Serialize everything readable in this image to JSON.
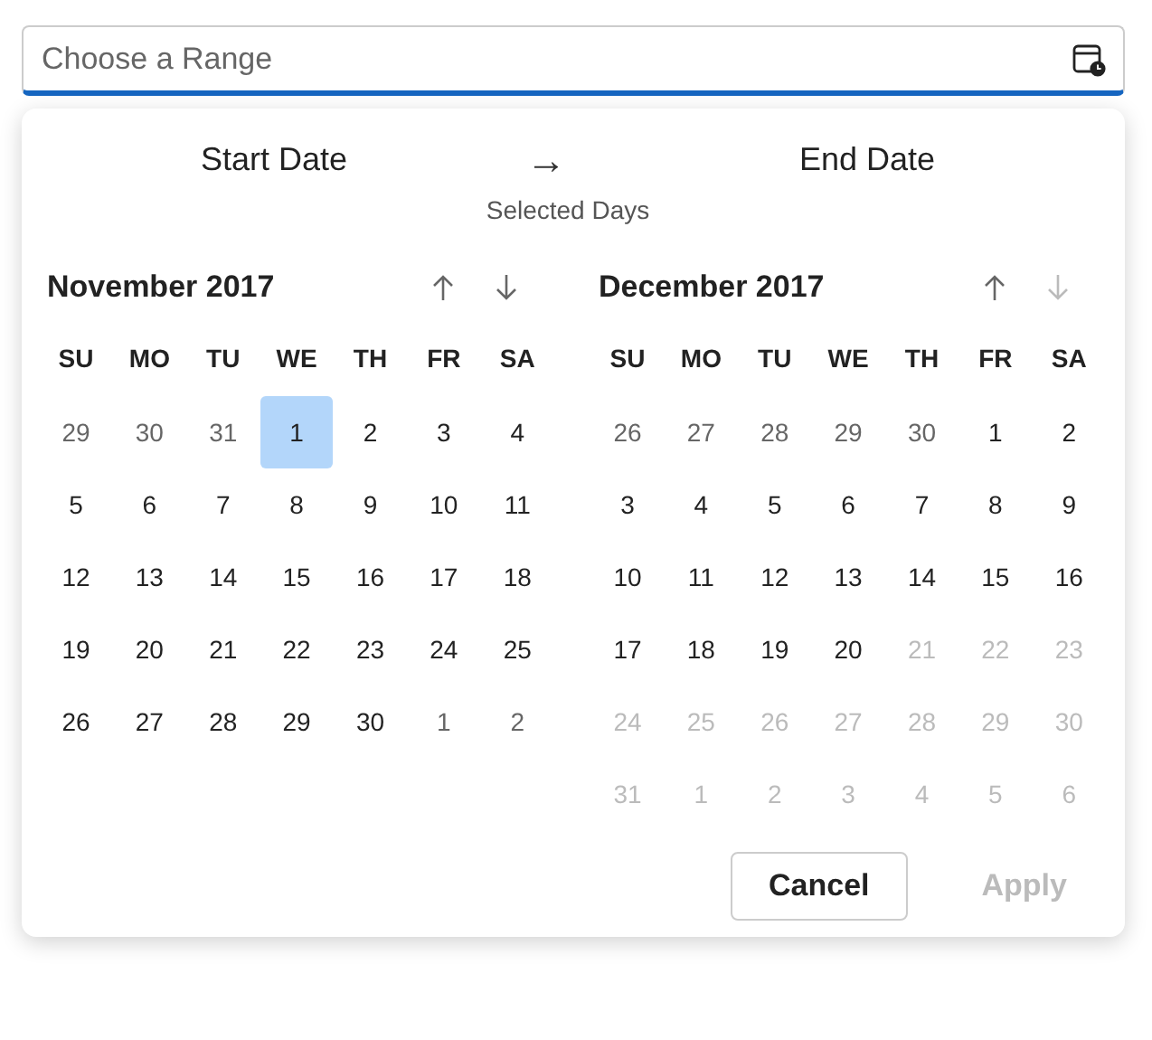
{
  "range_field": {
    "placeholder": "Choose a Range",
    "focused": true
  },
  "header": {
    "start_label": "Start Date",
    "arrow": "→",
    "end_label": "End Date",
    "caption": "Selected Days"
  },
  "months": [
    {
      "title": "November 2017",
      "nav": [
        {
          "kind": "up",
          "disabled": false
        },
        {
          "kind": "down",
          "disabled": false
        }
      ],
      "weekdays": [
        "SU",
        "MO",
        "TU",
        "WE",
        "TH",
        "FR",
        "SA"
      ],
      "weeks": [
        [
          {
            "label": "29",
            "kind": "out",
            "selected": false
          },
          {
            "label": "30",
            "kind": "out",
            "selected": false
          },
          {
            "label": "31",
            "kind": "out",
            "selected": false
          },
          {
            "label": "1",
            "kind": "in",
            "selected": true
          },
          {
            "label": "2",
            "kind": "in",
            "selected": false
          },
          {
            "label": "3",
            "kind": "in",
            "selected": false
          },
          {
            "label": "4",
            "kind": "in",
            "selected": false
          }
        ],
        [
          {
            "label": "5",
            "kind": "in",
            "selected": false
          },
          {
            "label": "6",
            "kind": "in",
            "selected": false
          },
          {
            "label": "7",
            "kind": "in",
            "selected": false
          },
          {
            "label": "8",
            "kind": "in",
            "selected": false
          },
          {
            "label": "9",
            "kind": "in",
            "selected": false
          },
          {
            "label": "10",
            "kind": "in",
            "selected": false
          },
          {
            "label": "11",
            "kind": "in",
            "selected": false
          }
        ],
        [
          {
            "label": "12",
            "kind": "in",
            "selected": false
          },
          {
            "label": "13",
            "kind": "in",
            "selected": false
          },
          {
            "label": "14",
            "kind": "in",
            "selected": false
          },
          {
            "label": "15",
            "kind": "in",
            "selected": false
          },
          {
            "label": "16",
            "kind": "in",
            "selected": false
          },
          {
            "label": "17",
            "kind": "in",
            "selected": false
          },
          {
            "label": "18",
            "kind": "in",
            "selected": false
          }
        ],
        [
          {
            "label": "19",
            "kind": "in",
            "selected": false
          },
          {
            "label": "20",
            "kind": "in",
            "selected": false
          },
          {
            "label": "21",
            "kind": "in",
            "selected": false
          },
          {
            "label": "22",
            "kind": "in",
            "selected": false
          },
          {
            "label": "23",
            "kind": "in",
            "selected": false
          },
          {
            "label": "24",
            "kind": "in",
            "selected": false
          },
          {
            "label": "25",
            "kind": "in",
            "selected": false
          }
        ],
        [
          {
            "label": "26",
            "kind": "in",
            "selected": false
          },
          {
            "label": "27",
            "kind": "in",
            "selected": false
          },
          {
            "label": "28",
            "kind": "in",
            "selected": false
          },
          {
            "label": "29",
            "kind": "in",
            "selected": false
          },
          {
            "label": "30",
            "kind": "in",
            "selected": false
          },
          {
            "label": "1",
            "kind": "out",
            "selected": false
          },
          {
            "label": "2",
            "kind": "out",
            "selected": false
          }
        ]
      ]
    },
    {
      "title": "December 2017",
      "nav": [
        {
          "kind": "up",
          "disabled": false
        },
        {
          "kind": "down",
          "disabled": true
        }
      ],
      "weekdays": [
        "SU",
        "MO",
        "TU",
        "WE",
        "TH",
        "FR",
        "SA"
      ],
      "weeks": [
        [
          {
            "label": "26",
            "kind": "out",
            "selected": false
          },
          {
            "label": "27",
            "kind": "out",
            "selected": false
          },
          {
            "label": "28",
            "kind": "out",
            "selected": false
          },
          {
            "label": "29",
            "kind": "out",
            "selected": false
          },
          {
            "label": "30",
            "kind": "out",
            "selected": false
          },
          {
            "label": "1",
            "kind": "in",
            "selected": false
          },
          {
            "label": "2",
            "kind": "in",
            "selected": false
          }
        ],
        [
          {
            "label": "3",
            "kind": "in",
            "selected": false
          },
          {
            "label": "4",
            "kind": "in",
            "selected": false
          },
          {
            "label": "5",
            "kind": "in",
            "selected": false
          },
          {
            "label": "6",
            "kind": "in",
            "selected": false
          },
          {
            "label": "7",
            "kind": "in",
            "selected": false
          },
          {
            "label": "8",
            "kind": "in",
            "selected": false
          },
          {
            "label": "9",
            "kind": "in",
            "selected": false
          }
        ],
        [
          {
            "label": "10",
            "kind": "in",
            "selected": false
          },
          {
            "label": "11",
            "kind": "in",
            "selected": false
          },
          {
            "label": "12",
            "kind": "in",
            "selected": false
          },
          {
            "label": "13",
            "kind": "in",
            "selected": false
          },
          {
            "label": "14",
            "kind": "in",
            "selected": false
          },
          {
            "label": "15",
            "kind": "in",
            "selected": false
          },
          {
            "label": "16",
            "kind": "in",
            "selected": false
          }
        ],
        [
          {
            "label": "17",
            "kind": "in",
            "selected": false
          },
          {
            "label": "18",
            "kind": "in",
            "selected": false
          },
          {
            "label": "19",
            "kind": "in",
            "selected": false
          },
          {
            "label": "20",
            "kind": "in",
            "selected": false
          },
          {
            "label": "21",
            "kind": "disabled",
            "selected": false
          },
          {
            "label": "22",
            "kind": "disabled",
            "selected": false
          },
          {
            "label": "23",
            "kind": "disabled",
            "selected": false
          }
        ],
        [
          {
            "label": "24",
            "kind": "disabled",
            "selected": false
          },
          {
            "label": "25",
            "kind": "disabled",
            "selected": false
          },
          {
            "label": "26",
            "kind": "disabled",
            "selected": false
          },
          {
            "label": "27",
            "kind": "disabled",
            "selected": false
          },
          {
            "label": "28",
            "kind": "disabled",
            "selected": false
          },
          {
            "label": "29",
            "kind": "disabled",
            "selected": false
          },
          {
            "label": "30",
            "kind": "disabled",
            "selected": false
          }
        ],
        [
          {
            "label": "31",
            "kind": "disabled",
            "selected": false
          },
          {
            "label": "1",
            "kind": "disabled",
            "selected": false
          },
          {
            "label": "2",
            "kind": "disabled",
            "selected": false
          },
          {
            "label": "3",
            "kind": "disabled",
            "selected": false
          },
          {
            "label": "4",
            "kind": "disabled",
            "selected": false
          },
          {
            "label": "5",
            "kind": "disabled",
            "selected": false
          },
          {
            "label": "6",
            "kind": "disabled",
            "selected": false
          }
        ]
      ]
    }
  ],
  "buttons": [
    {
      "label": "Cancel",
      "kind": "secondary",
      "disabled": false
    },
    {
      "label": "Apply",
      "kind": "primary",
      "disabled": true
    }
  ]
}
